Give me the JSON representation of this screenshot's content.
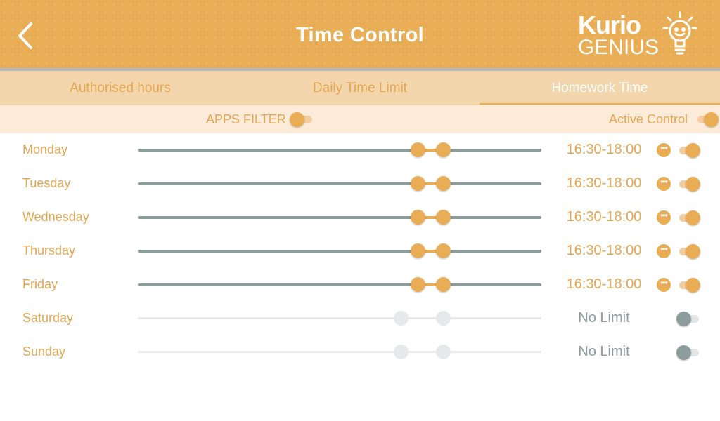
{
  "header": {
    "title": "Time Control",
    "logo_top": "Kurio",
    "logo_bottom": "GENIUS"
  },
  "tabs": [
    {
      "label": "Authorised hours",
      "active": false
    },
    {
      "label": "Daily Time Limit",
      "active": false
    },
    {
      "label": "Homework Time",
      "active": true
    }
  ],
  "filters": {
    "apps_filter_label": "APPS FILTER",
    "apps_filter_on": false,
    "active_control_label": "Active Control",
    "active_control_on": true
  },
  "days": [
    {
      "name": "Monday",
      "time": "16:30-18:00",
      "enabled": true,
      "range_start": 0.695,
      "range_end": 0.757
    },
    {
      "name": "Tuesday",
      "time": "16:30-18:00",
      "enabled": true,
      "range_start": 0.695,
      "range_end": 0.757
    },
    {
      "name": "Wednesday",
      "time": "16:30-18:00",
      "enabled": true,
      "range_start": 0.695,
      "range_end": 0.757
    },
    {
      "name": "Thursday",
      "time": "16:30-18:00",
      "enabled": true,
      "range_start": 0.695,
      "range_end": 0.757
    },
    {
      "name": "Friday",
      "time": "16:30-18:00",
      "enabled": true,
      "range_start": 0.695,
      "range_end": 0.757
    },
    {
      "name": "Saturday",
      "time": "No Limit",
      "enabled": false,
      "range_start": 0.653,
      "range_end": 0.757
    },
    {
      "name": "Sunday",
      "time": "No Limit",
      "enabled": false,
      "range_start": 0.653,
      "range_end": 0.757
    }
  ],
  "icons": {
    "back": "chevron-left-icon",
    "more": "more-options-icon",
    "logo": "lightbulb-icon"
  },
  "colors": {
    "accent": "#e9ad55",
    "accent_text": "#e4a653",
    "inactive": "#8c9d9d",
    "tab_bg": "#f3d6ab",
    "filter_bg": "#fbebd8"
  }
}
